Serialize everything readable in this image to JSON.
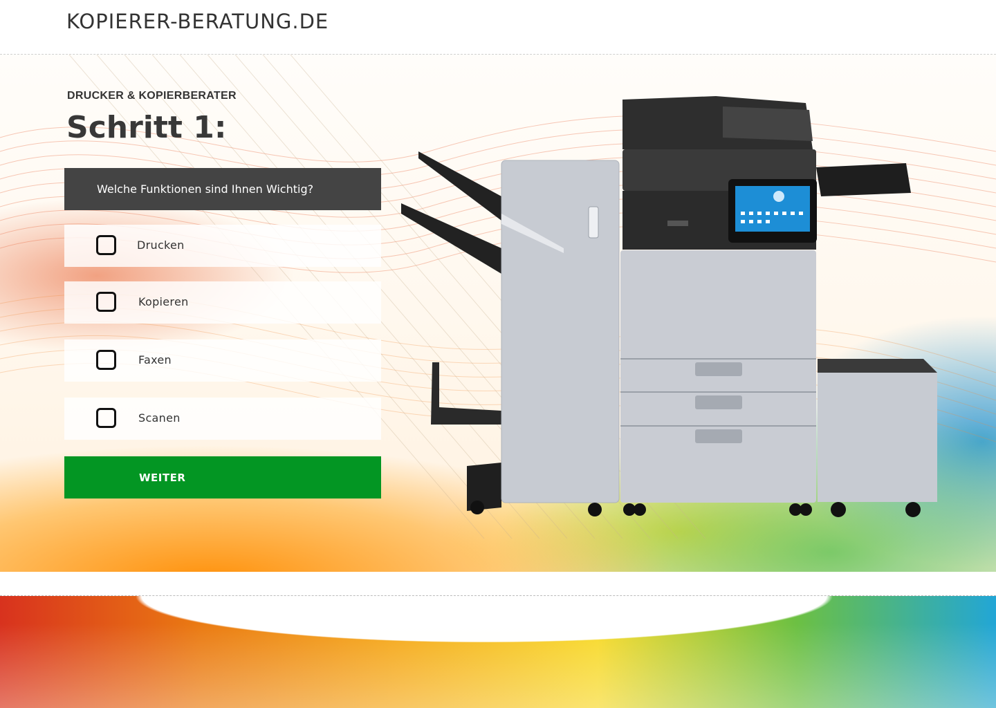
{
  "header": {
    "site_title": "KOPIERER-BERATUNG.DE"
  },
  "hero": {
    "section_label": "DRUCKER & KOPIERBERATER",
    "step_title": "Schritt 1:",
    "question": "Welche Funktionen sind Ihnen Wichtig?",
    "options": [
      {
        "label": "Drucken",
        "checked": false
      },
      {
        "label": "Kopieren",
        "checked": false
      },
      {
        "label": "Faxen",
        "checked": false
      },
      {
        "label": "Scanen",
        "checked": false
      }
    ],
    "next_label": "WEITER"
  },
  "colors": {
    "question_bg": "#444444",
    "button_green": "#039623",
    "text_dark": "#333333"
  }
}
